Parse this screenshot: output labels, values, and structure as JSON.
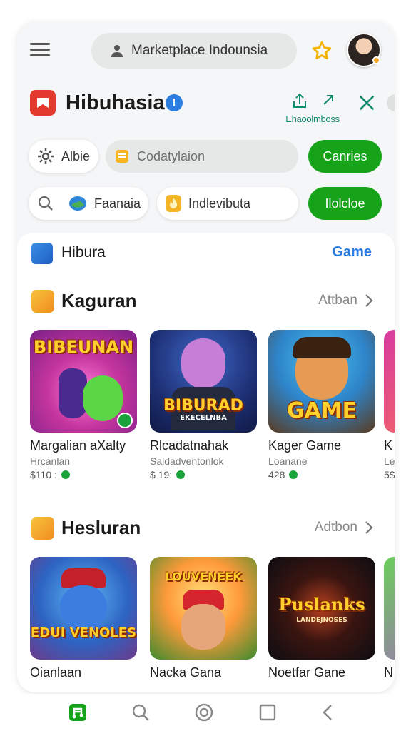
{
  "search": {
    "label": "Marketplace Indounsia"
  },
  "app": {
    "title": "Hibuhasia",
    "badge": "!",
    "share_label": "Ehaoolmboss"
  },
  "chips_row1": [
    {
      "label": "Albie",
      "icon": "gear-icon"
    },
    {
      "label": "Codatylaion",
      "icon": "clipboard-icon"
    },
    {
      "label": "Canries"
    }
  ],
  "chips_row2": [
    {
      "label": "",
      "icon": "search-icon"
    },
    {
      "label": "Faanaia",
      "icon": "globe-icon"
    },
    {
      "label": "Indlevibuta",
      "icon": "flame-icon"
    },
    {
      "label": "Ilolcloe"
    }
  ],
  "card": {
    "title": "Hibura",
    "link": "Game"
  },
  "sections": [
    {
      "title": "Kaguran",
      "more": "Attban",
      "games": [
        {
          "name": "Margalian aXalty",
          "sub": "Hrcanlan",
          "price": "$110 :",
          "art": "BIBEUNAN"
        },
        {
          "name": "Rlcadatnahak",
          "sub": "Saldadventonlok",
          "price": "$ 19:",
          "art": "BIBURAD",
          "art_sub": "EKECELNBA"
        },
        {
          "name": "Kager Game",
          "sub": "Loanane",
          "price": "428",
          "art": "GAME"
        },
        {
          "name": "K",
          "sub": "Le",
          "price": "5$",
          "art": ""
        }
      ]
    },
    {
      "title": "Hesluran",
      "more": "Adtbon",
      "games": [
        {
          "name": "Oianlaan",
          "sub": "",
          "price": "",
          "art": "EDUI VENOLES"
        },
        {
          "name": "Nacka Gana",
          "sub": "",
          "price": "",
          "art": "LOUVENEEK"
        },
        {
          "name": "Noetfar Gane",
          "sub": "",
          "price": "",
          "art": "Puslanks",
          "art_sub": "LANDEJNOSES"
        },
        {
          "name": "N",
          "sub": "",
          "price": "",
          "art": ""
        }
      ]
    }
  ],
  "nav": [
    "home-icon",
    "search-icon",
    "discover-icon",
    "recent-apps-icon",
    "back-icon"
  ],
  "colors": {
    "accent_green": "#17a319",
    "link_blue": "#2a7de1",
    "logo_red": "#e23b2e"
  }
}
